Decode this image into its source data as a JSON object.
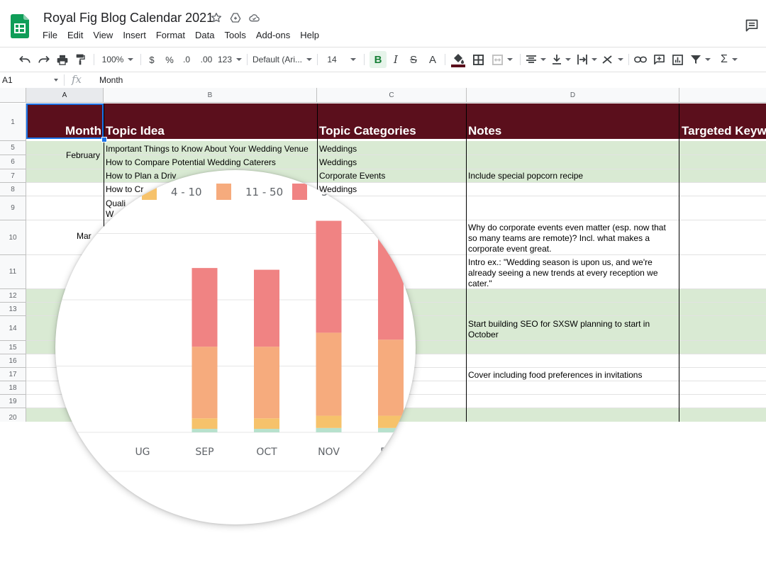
{
  "app": {
    "title": "Royal Fig Blog Calendar 2021",
    "icons": [
      "sheets-logo-icon",
      "star-icon",
      "move-to-drive-icon",
      "cloud-saved-icon",
      "comments-icon"
    ]
  },
  "menu": [
    "File",
    "Edit",
    "View",
    "Insert",
    "Format",
    "Data",
    "Tools",
    "Add-ons",
    "Help"
  ],
  "toolbar": {
    "zoom": "100%",
    "currency": "$",
    "percent": "%",
    "decimal_decrease": ".0",
    "decimal_increase": ".00",
    "more_formats": "123",
    "font": "Default (Ari...",
    "font_size": "14",
    "bold": "B",
    "italic": "I",
    "strikethrough": "S",
    "text_color": "A",
    "fill_accent": "#5b0f1c"
  },
  "formula_bar": {
    "name_box": "A1",
    "fx": "fx",
    "value": "Month"
  },
  "sheet": {
    "columns": [
      "A",
      "B",
      "C",
      "D"
    ],
    "header": {
      "row_number": "1",
      "month": "Month",
      "topic_idea": "Topic Idea",
      "topic_categories": "Topic Categories",
      "notes": "Notes",
      "targeted_keywords": "Targeted Keyw"
    },
    "row_numbers": [
      "5",
      "6",
      "7",
      "8",
      "9",
      "10",
      "11",
      "12",
      "13",
      "14",
      "15",
      "16",
      "17",
      "18",
      "19",
      "20"
    ],
    "month_labels": {
      "february": "February",
      "march_fragment": "Mar"
    },
    "topics": {
      "r5": "Important Things to Know About Your Wedding Venue",
      "r6": "How to Compare Potential Wedding Caterers",
      "r7": "How to Plan a Driv",
      "r8": "How to Cr",
      "r9a": "Quali",
      "r9b": "W"
    },
    "categories": {
      "r5": "Weddings",
      "r6": "Weddings",
      "r7": "Corporate Events",
      "r8": "Weddings"
    },
    "notes": {
      "r7": "Include special popcorn recipe",
      "r10": "Why do corporate events even matter (esp. now that so many teams are remote)? Incl. what makes a corporate event great.",
      "r11": "Intro ex.: \"Wedding season is upon us, and we're already seeing a new trends at every reception we cater.\"",
      "r14": "Start building SEO for SXSW planning to start in October",
      "r17": "Cover including food preferences in invitations"
    },
    "colors": {
      "header_fill": "#5b0f1c",
      "band_green": "#d9ead3",
      "selection": "#1a73e8"
    }
  },
  "chart_data": {
    "type": "bar",
    "stacked": true,
    "categories": [
      "AUG",
      "SEP",
      "OCT",
      "NOV",
      "DEC"
    ],
    "series": [
      {
        "name": "",
        "color": "#b7e1cd",
        "values": [
          0,
          4,
          4,
          5,
          5
        ]
      },
      {
        "name": "4 - 10",
        "color": "#f6c26b",
        "values": [
          0,
          12,
          12,
          14,
          14
        ]
      },
      {
        "name": "11 - 50",
        "color": "#f6ab7d",
        "values": [
          0,
          82,
          82,
          95,
          87
        ]
      },
      {
        "name": "5",
        "color": "#f08383",
        "values": [
          0,
          90,
          88,
          128,
          145
        ]
      }
    ],
    "legend_position": "top",
    "visible_tick_labels": [
      "UG",
      "SEP",
      "OCT",
      "NOV",
      "DEC"
    ],
    "ylim": [
      0,
      300
    ],
    "grid": true
  }
}
